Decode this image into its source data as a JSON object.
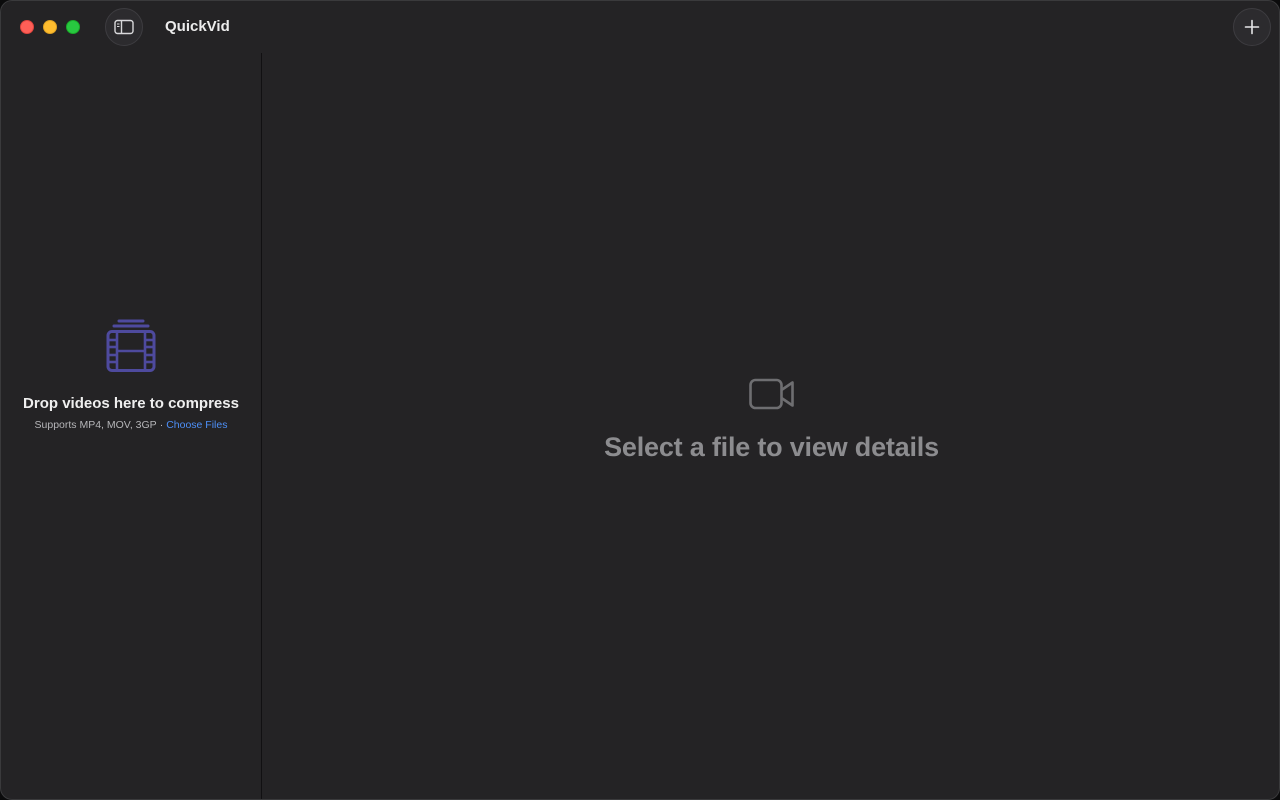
{
  "window": {
    "title": "QuickVid",
    "controls": [
      "close",
      "minimize",
      "zoom"
    ]
  },
  "toolbar": {
    "sidebar_toggle_icon": "sidebar-toggle-icon",
    "add_icon": "plus-icon"
  },
  "sidebar": {
    "drop_zone": {
      "icon": "film-stack-icon",
      "title": "Drop videos here to compress",
      "supported": "Supports MP4, MOV, 3GP",
      "separator": "·",
      "choose_label": "Choose Files"
    }
  },
  "main": {
    "empty_state": {
      "icon": "video-camera-icon",
      "message": "Select a file to view details"
    }
  },
  "colors": {
    "background": "#242325",
    "accent_link": "#4d8ff7",
    "film_icon": "#4e4a9e",
    "muted_text": "#8c8c8f"
  }
}
